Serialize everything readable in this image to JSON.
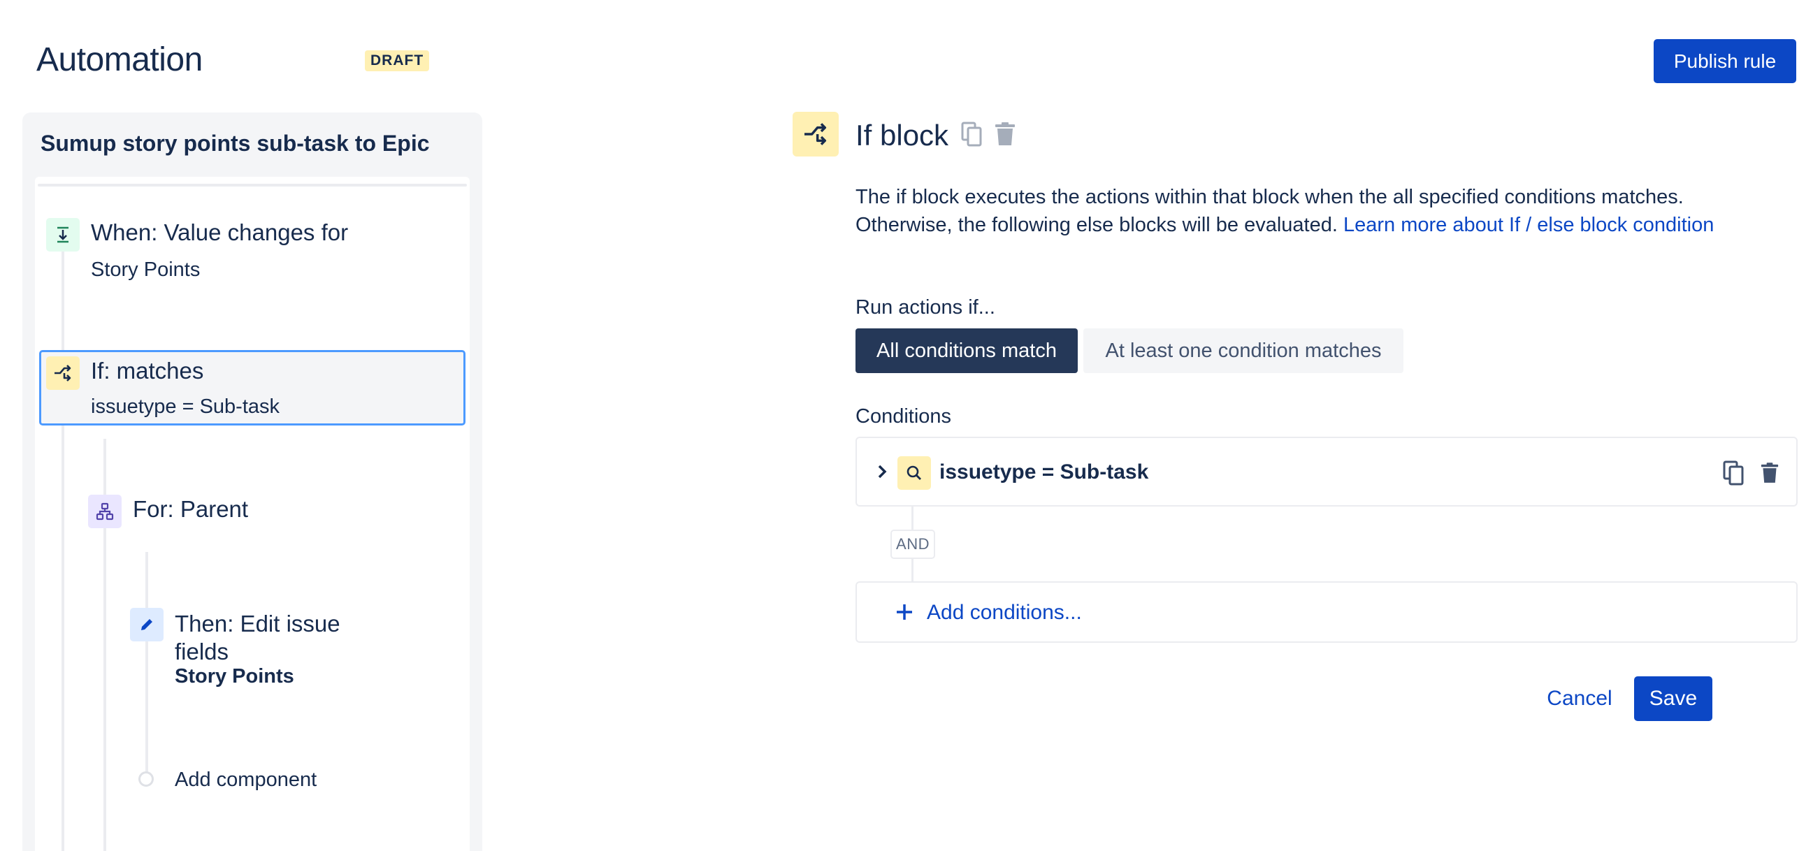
{
  "header": {
    "app_title": "Automation",
    "status_badge": "DRAFT",
    "publish_label": "Publish rule"
  },
  "rule": {
    "name": "Sumup story points sub-task to Epic",
    "components": [
      {
        "type": "trigger",
        "icon": "trigger-icon",
        "title": "When: Value changes for",
        "subtitle": "Story Points",
        "color": "#e3fcef"
      },
      {
        "type": "condition",
        "icon": "branch-icon",
        "title": "If: matches",
        "subtitle": "issuetype = Sub-task",
        "color": "#fff0b3",
        "selected": true
      },
      {
        "type": "branch",
        "icon": "hierarchy-icon",
        "title": "For: Parent",
        "subtitle": "",
        "color": "#eae6ff"
      },
      {
        "type": "action",
        "icon": "pencil-icon",
        "title_line1": "Then: Edit issue",
        "title_line2": "fields",
        "subtitle": "Story Points",
        "color": "#deebff"
      }
    ],
    "add_component_label": "Add component"
  },
  "detail": {
    "title": "If block",
    "description": "The if block executes the actions within that block when the all specified conditions matches. Otherwise, the following else blocks will be evaluated.",
    "learn_more_label": "Learn more about If / else block condition",
    "run_actions_label": "Run actions if...",
    "match_options": [
      "All conditions match",
      "At least one condition matches"
    ],
    "selected_match": "All conditions match",
    "conditions_label": "Conditions",
    "conditions": [
      {
        "text": "issuetype = Sub-task",
        "icon": "search-icon"
      }
    ],
    "joiner": "AND",
    "add_conditions_label": "Add conditions...",
    "cancel_label": "Cancel",
    "save_label": "Save"
  },
  "colors": {
    "primary": "#0c47c5",
    "selected_border": "#4c9aff",
    "condition_yellow": "#fff0b3",
    "segment_active": "#253858"
  }
}
